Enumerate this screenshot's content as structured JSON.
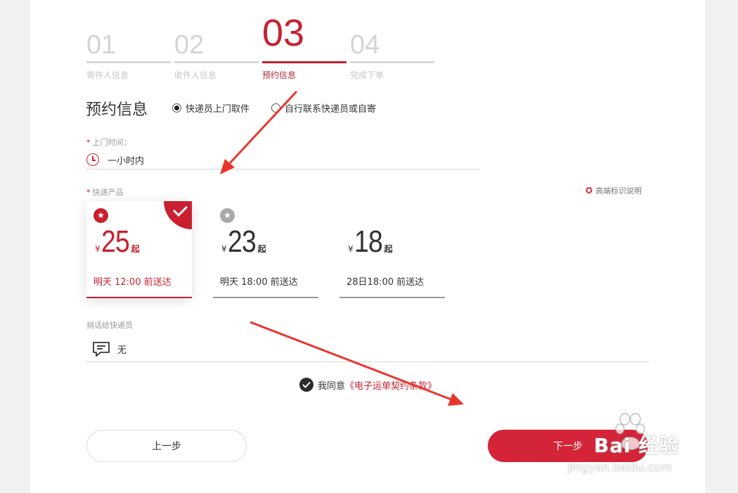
{
  "steps": [
    {
      "num": "01",
      "label": "寄件人信息",
      "state": "done"
    },
    {
      "num": "02",
      "label": "收件人信息",
      "state": "done"
    },
    {
      "num": "03",
      "label": "预约信息",
      "state": "active"
    },
    {
      "num": "04",
      "label": "完成下单",
      "state": "todo"
    }
  ],
  "section": {
    "title": "预约信息",
    "pickup_options": [
      {
        "label": "快递员上门取件",
        "selected": true
      },
      {
        "label": "自行联系快递员或自寄",
        "selected": false
      }
    ]
  },
  "pickup_time": {
    "label": "上门时间：",
    "value": "一小时内"
  },
  "products": {
    "label": "快递产品",
    "hint": "高端标识说明",
    "items": [
      {
        "currency": "¥",
        "price": "25",
        "suffix": "起",
        "delivery": "明天 12:00 前送达",
        "selected": true
      },
      {
        "currency": "¥",
        "price": "23",
        "suffix": "起",
        "delivery": "明天 18:00 前送达",
        "selected": false
      },
      {
        "currency": "¥",
        "price": "18",
        "suffix": "起",
        "delivery": "28日18:00 前送达",
        "selected": false
      }
    ]
  },
  "message": {
    "label": "捎话给快递员",
    "value": "无"
  },
  "agreement": {
    "prefix": "我同意",
    "link": "《电子运单契约条款》",
    "checked": true
  },
  "buttons": {
    "prev": "上一步",
    "next": "下一步"
  },
  "watermark": {
    "text": "Bai 经验",
    "sub": "jingyan.baidu.com"
  },
  "colors": {
    "accent": "#c8202f",
    "button": "#d42437"
  }
}
